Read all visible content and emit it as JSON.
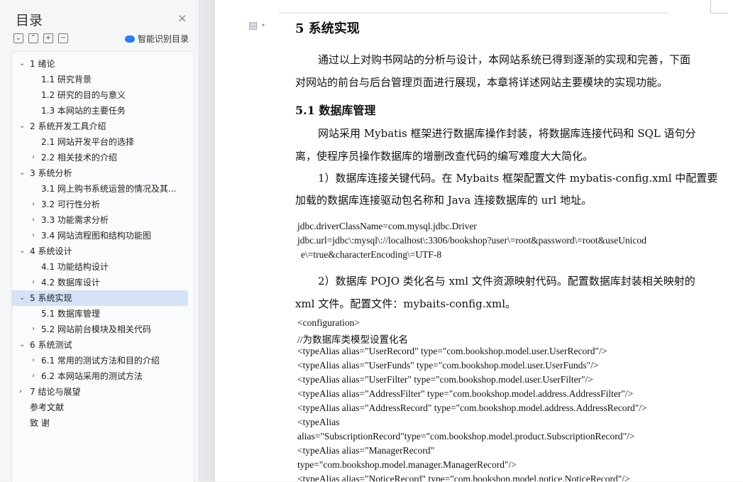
{
  "sidebar": {
    "title": "目录",
    "close": "×",
    "tools": [
      "⌄",
      "⌃",
      "+",
      "−"
    ],
    "smart_label": "智能识别目录",
    "toc": [
      {
        "label": "1  绪论",
        "level": 1,
        "chev": "⌄"
      },
      {
        "label": "1.1 研究背景",
        "level": 2,
        "chev": ""
      },
      {
        "label": "1.2 研究的目的与意义",
        "level": 2,
        "chev": ""
      },
      {
        "label": "1.3 本网站的主要任务",
        "level": 2,
        "chev": ""
      },
      {
        "label": "2  系统开发工具介绍",
        "level": 1,
        "chev": "⌄"
      },
      {
        "label": "2.1 网站开发平台的选择",
        "level": 2,
        "chev": ""
      },
      {
        "label": "2.2 相关技术的介绍",
        "level": 2,
        "chev": "›"
      },
      {
        "label": "3  系统分析",
        "level": 1,
        "chev": "⌄"
      },
      {
        "label": "3.1  网上购书系统运营的情况及其...",
        "level": 2,
        "chev": ""
      },
      {
        "label": "3.2  可行性分析",
        "level": 2,
        "chev": "›"
      },
      {
        "label": "3.3  功能需求分析",
        "level": 2,
        "chev": "›"
      },
      {
        "label": "3.4 网站流程图和结构功能图",
        "level": 2,
        "chev": "›"
      },
      {
        "label": "4  系统设计",
        "level": 1,
        "chev": "⌄"
      },
      {
        "label": "4.1 功能结构设计",
        "level": 2,
        "chev": ""
      },
      {
        "label": "4.2  数据库设计",
        "level": 2,
        "chev": "›"
      },
      {
        "label": "5  系统实现",
        "level": 1,
        "chev": "⌄",
        "selected": true
      },
      {
        "label": "5.1  数据库管理",
        "level": 2,
        "chev": ""
      },
      {
        "label": "5.2  网站前台模块及相关代码",
        "level": 2,
        "chev": "›"
      },
      {
        "label": "6  系统测试",
        "level": 1,
        "chev": "⌄"
      },
      {
        "label": "6.1 常用的测试方法和目的介绍",
        "level": 2,
        "chev": "›"
      },
      {
        "label": "6.2 本网站采用的测试方法",
        "level": 2,
        "chev": "›"
      },
      {
        "label": "7  结论与展望",
        "level": 1,
        "chev": "›"
      },
      {
        "label": "参考文献",
        "level": 0,
        "chev": ""
      },
      {
        "label": "致    谢",
        "level": 0,
        "chev": ""
      }
    ]
  },
  "doc": {
    "heading": "5  系统实现",
    "intro_lines": [
      "通过以上对购书网站的分析与设计，本网站系统已得到逐渐的实现和完善，下面",
      "对网站的前台与后台管理页面进行展现，本章将详述网站主要模块的实现功能。"
    ],
    "sub_heading": "5.1  数据库管理",
    "p1_lines": [
      "网站采用 Mybatis 框架进行数据库操作封装，将数据库连接代码和 SQL 语句分",
      "离，使程序员操作数据库的增删改查代码的编写难度大大简化。"
    ],
    "p2_lines": [
      "1）数据库连接关键代码。在 Mybaits 框架配置文件 mybatis-config.xml 中配置要",
      "加载的数据库连接驱动包名称和 Java 连接数据库的 url 地址。"
    ],
    "code_lines": [
      "jdbc.driverClassName=com.mysql.jdbc.Driver",
      "jdbc.url=jdbc\\:mysql\\://localhost\\:3306/bookshop?user\\=root&password\\=root&useUnicod",
      "e\\=true&characterEncoding\\=UTF-8"
    ],
    "p3_lines": [
      "2）数据库 POJO 类化名与 xml 文件资源映射代码。配置数据库封装相关映射的",
      "xml 文件。配置文件：mybaits-config.xml。"
    ],
    "xml_lines": [
      "<configuration>",
      "//为数据库类模型设置化名",
      "<typeAlias alias=\"UserRecord\" type=\"com.bookshop.model.user.UserRecord\"/>",
      "<typeAlias alias=\"UserFunds\" type=\"com.bookshop.model.user.UserFunds\"/>",
      "<typeAlias alias=\"UserFilter\" type=\"com.bookshop.model.user.UserFilter\"/>",
      "<typeAlias alias=\"AddressFilter\" type=\"com.bookshop.model.address.AddressFilter\"/>",
      "<typeAlias alias=\"AddressRecord\" type=\"com.bookshop.model.address.AddressRecord\"/>",
      "<typeAlias",
      "alias=\"SubscriptionRecord\"type=\"com.bookshop.model.product.SubscriptionRecord\"/>",
      "<typeAlias alias=\"ManagerRecord\"",
      "type=\"com.bookshop.model.manager.ManagerRecord\"/>",
      "<typeAlias alias=\"NoticeRecord\" type=\"com.bookshop.model.notice.NoticeRecord\"/>"
    ]
  }
}
